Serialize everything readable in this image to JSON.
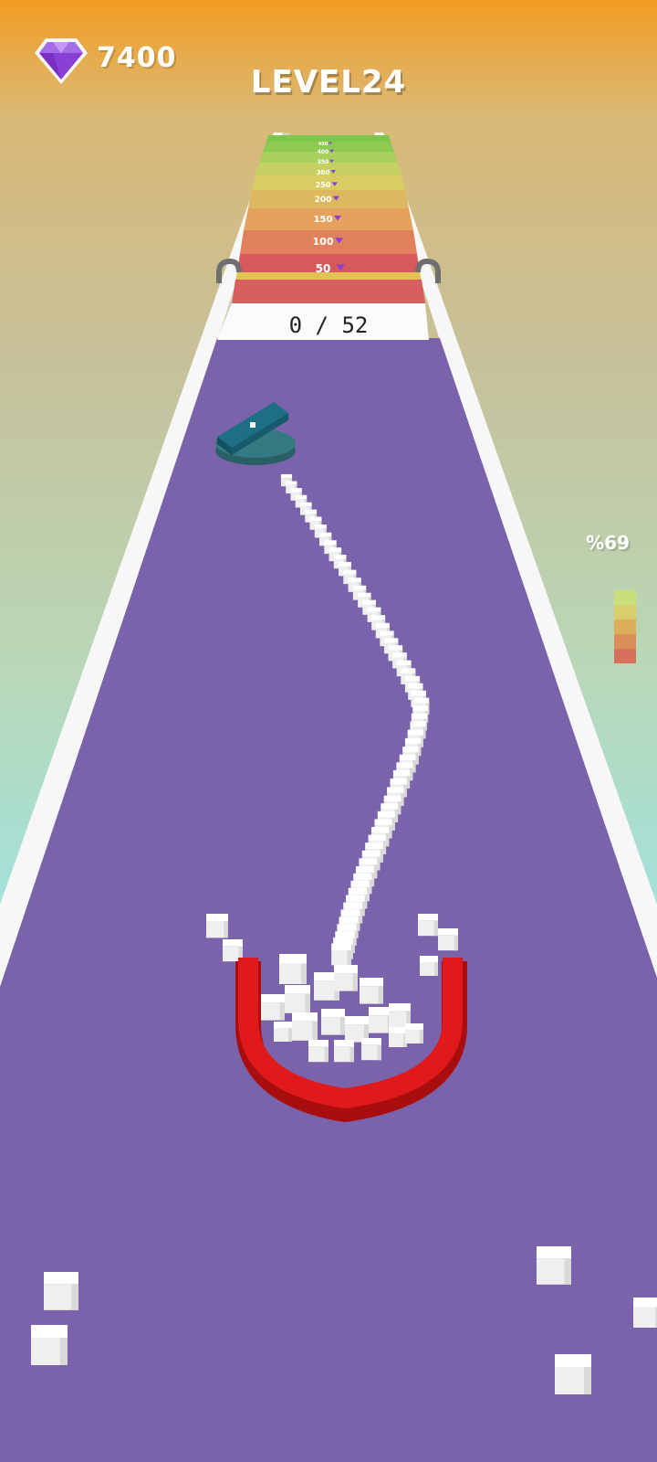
{
  "hud": {
    "gem_count": "7400",
    "level": "LEVEL24",
    "progress": "%69"
  },
  "track": {
    "counter": "0 / 52",
    "finish_labels": [
      "50",
      "100",
      "150",
      "200",
      "250",
      "300",
      "350",
      "400",
      "450"
    ]
  },
  "colors": {
    "track": "#7a63aa",
    "gem": "#8a3fd6",
    "magnet": "#d81212",
    "bumper": "#2a6c74"
  },
  "meter_colors": [
    "#c9e07a",
    "#d8cf6c",
    "#dcae5c",
    "#dc8e5a",
    "#d6705a"
  ],
  "icons": {
    "gem": "diamond-icon"
  }
}
